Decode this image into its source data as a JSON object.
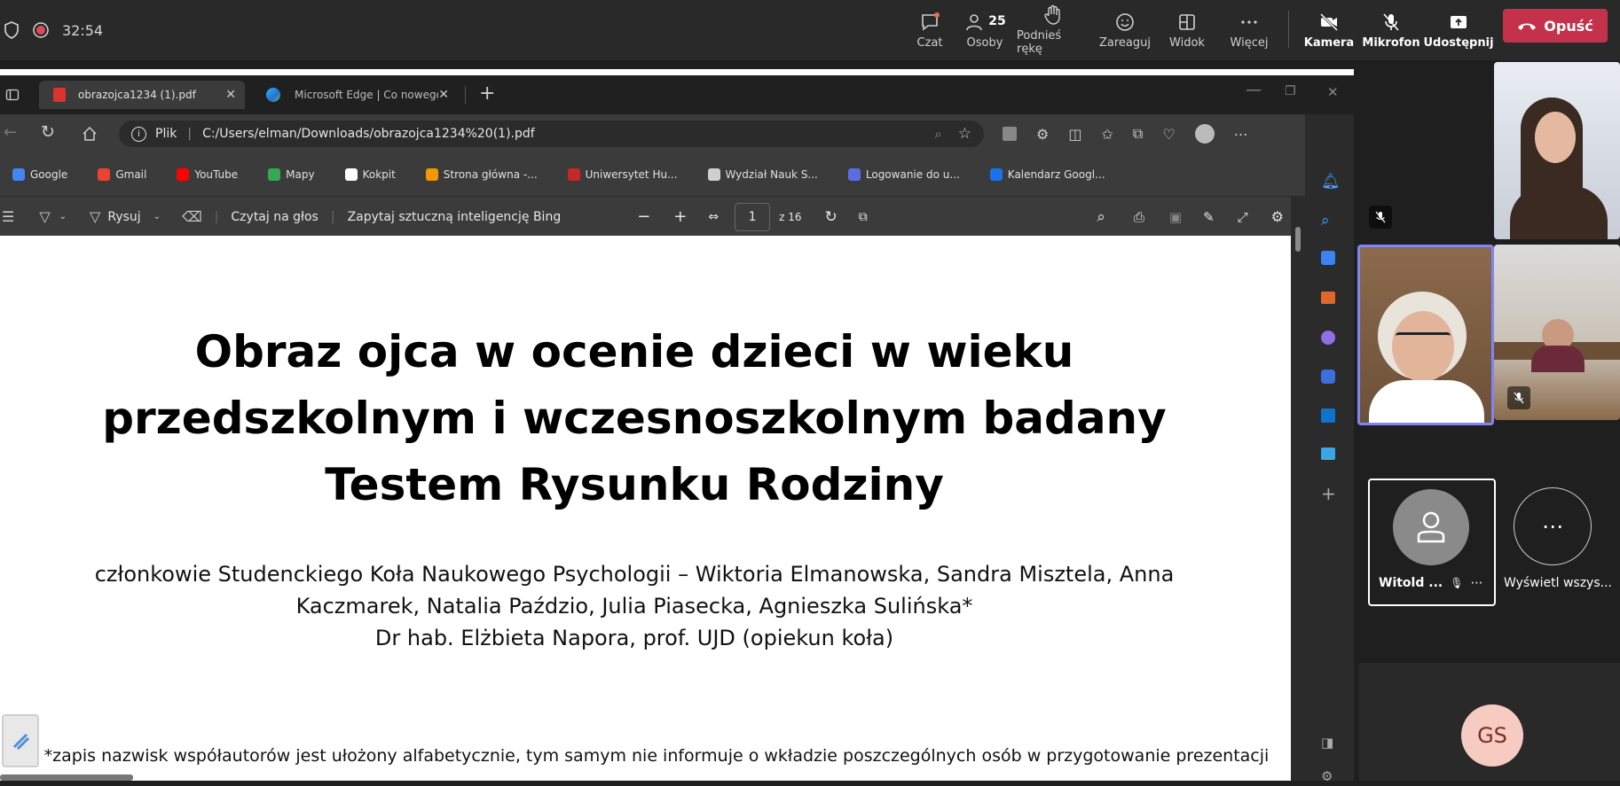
{
  "teams": {
    "timer": "32:54",
    "buttons": {
      "chat": "Czat",
      "people": "Osoby",
      "people_count": "25",
      "raise_hand": "Podnieś rękę",
      "react": "Zareaguj",
      "view": "Widok",
      "more": "Więcej",
      "camera": "Kamera",
      "mic": "Mikrofon",
      "share": "Udostępnij",
      "leave": "Opuść"
    },
    "colors": {
      "leave": "#c4314b",
      "bar": "#292929"
    }
  },
  "browser": {
    "tabs": [
      {
        "label": "obrazojca1234 (1).pdf",
        "active": true
      },
      {
        "label": "Microsoft Edge | Co nowego",
        "active": false
      }
    ],
    "address": {
      "scheme": "Plik",
      "url": "C:/Users/elman/Downloads/obrazojca1234%20(1).pdf"
    },
    "bookmarks": [
      {
        "label": "Google",
        "color": "#4285f4"
      },
      {
        "label": "Gmail",
        "color": "#ea4335"
      },
      {
        "label": "YouTube",
        "color": "#ff0000"
      },
      {
        "label": "Mapy",
        "color": "#34a853"
      },
      {
        "label": "Kokpit",
        "color": "#ffffff"
      },
      {
        "label": "Strona główna -...",
        "color": "#f29900"
      },
      {
        "label": "Uniwersytet Hu...",
        "color": "#c62828"
      },
      {
        "label": "Wydział Nauk S...",
        "color": "#cfcfcf"
      },
      {
        "label": "Logowanie do u...",
        "color": "#5b6ee1"
      },
      {
        "label": "Kalendarz Googl...",
        "color": "#1a73e8"
      }
    ],
    "pdf_toolbar": {
      "draw": "Rysuj",
      "read_aloud": "Czytaj na głos",
      "ask_bing": "Zapytaj sztuczną inteligencję Bing",
      "page_current": "1",
      "page_total": "z 16"
    }
  },
  "slide": {
    "title": "Obraz ojca w ocenie dzieci w wieku przedszkolnym i wczesnoszkolnym badany Testem Rysunku Rodziny",
    "authors_line1": "członkowie Studenckiego Koła Naukowego Psychologii – Wiktoria Elmanowska, Sandra Misztela, Anna Kaczmarek, Natalia Paździo, Julia Piasecka, Agnieszka Sulińska*",
    "authors_line2": "Dr hab. Elżbieta Napora, prof. UJD (opiekun koła)",
    "footnote": "*zapis nazwisk współautorów jest ułożony alfabetycznie, tym samym nie informuje o wkładzie poszczególnych osób w przygotowanie prezentacji"
  },
  "participants": {
    "witold_name": "Witold ...",
    "view_all": "Wyświetl wszys...",
    "gs_initials": "GS"
  }
}
